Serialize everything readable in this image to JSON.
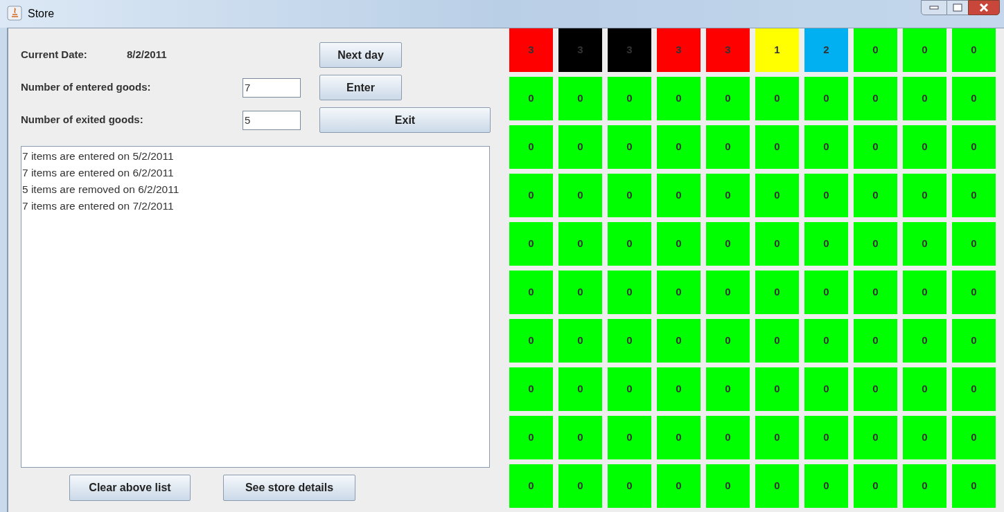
{
  "window": {
    "title": "Store"
  },
  "current_date": {
    "label": "Current Date:",
    "value": "8/2/2011"
  },
  "next_day_button": "Next day",
  "entered": {
    "label": "Number of entered goods:",
    "value": "7",
    "button": "Enter"
  },
  "exited": {
    "label": "Number of exited goods:",
    "value": "5",
    "button": "Exit"
  },
  "log": [
    "7 items are entered on 5/2/2011",
    "7 items are entered on 6/2/2011",
    "5 items are removed on 6/2/2011",
    "7 items are entered on 7/2/2011"
  ],
  "bottom_buttons": [
    "Clear above list",
    "See store details"
  ],
  "grid": [
    [
      {
        "value": "3",
        "color": "#ff0000"
      },
      {
        "value": "3",
        "color": "#000000"
      },
      {
        "value": "3",
        "color": "#000000"
      },
      {
        "value": "3",
        "color": "#ff0000"
      },
      {
        "value": "3",
        "color": "#ff0000"
      },
      {
        "value": "1",
        "color": "#ffff00"
      },
      {
        "value": "2",
        "color": "#00b0f0"
      },
      {
        "value": "0",
        "color": "#00ff00"
      },
      {
        "value": "0",
        "color": "#00ff00"
      },
      {
        "value": "0",
        "color": "#00ff00"
      }
    ],
    [
      {
        "value": "0",
        "color": "#00ff00"
      },
      {
        "value": "0",
        "color": "#00ff00"
      },
      {
        "value": "0",
        "color": "#00ff00"
      },
      {
        "value": "0",
        "color": "#00ff00"
      },
      {
        "value": "0",
        "color": "#00ff00"
      },
      {
        "value": "0",
        "color": "#00ff00"
      },
      {
        "value": "0",
        "color": "#00ff00"
      },
      {
        "value": "0",
        "color": "#00ff00"
      },
      {
        "value": "0",
        "color": "#00ff00"
      },
      {
        "value": "0",
        "color": "#00ff00"
      }
    ],
    [
      {
        "value": "0",
        "color": "#00ff00"
      },
      {
        "value": "0",
        "color": "#00ff00"
      },
      {
        "value": "0",
        "color": "#00ff00"
      },
      {
        "value": "0",
        "color": "#00ff00"
      },
      {
        "value": "0",
        "color": "#00ff00"
      },
      {
        "value": "0",
        "color": "#00ff00"
      },
      {
        "value": "0",
        "color": "#00ff00"
      },
      {
        "value": "0",
        "color": "#00ff00"
      },
      {
        "value": "0",
        "color": "#00ff00"
      },
      {
        "value": "0",
        "color": "#00ff00"
      }
    ],
    [
      {
        "value": "0",
        "color": "#00ff00"
      },
      {
        "value": "0",
        "color": "#00ff00"
      },
      {
        "value": "0",
        "color": "#00ff00"
      },
      {
        "value": "0",
        "color": "#00ff00"
      },
      {
        "value": "0",
        "color": "#00ff00"
      },
      {
        "value": "0",
        "color": "#00ff00"
      },
      {
        "value": "0",
        "color": "#00ff00"
      },
      {
        "value": "0",
        "color": "#00ff00"
      },
      {
        "value": "0",
        "color": "#00ff00"
      },
      {
        "value": "0",
        "color": "#00ff00"
      }
    ],
    [
      {
        "value": "0",
        "color": "#00ff00"
      },
      {
        "value": "0",
        "color": "#00ff00"
      },
      {
        "value": "0",
        "color": "#00ff00"
      },
      {
        "value": "0",
        "color": "#00ff00"
      },
      {
        "value": "0",
        "color": "#00ff00"
      },
      {
        "value": "0",
        "color": "#00ff00"
      },
      {
        "value": "0",
        "color": "#00ff00"
      },
      {
        "value": "0",
        "color": "#00ff00"
      },
      {
        "value": "0",
        "color": "#00ff00"
      },
      {
        "value": "0",
        "color": "#00ff00"
      }
    ],
    [
      {
        "value": "0",
        "color": "#00ff00"
      },
      {
        "value": "0",
        "color": "#00ff00"
      },
      {
        "value": "0",
        "color": "#00ff00"
      },
      {
        "value": "0",
        "color": "#00ff00"
      },
      {
        "value": "0",
        "color": "#00ff00"
      },
      {
        "value": "0",
        "color": "#00ff00"
      },
      {
        "value": "0",
        "color": "#00ff00"
      },
      {
        "value": "0",
        "color": "#00ff00"
      },
      {
        "value": "0",
        "color": "#00ff00"
      },
      {
        "value": "0",
        "color": "#00ff00"
      }
    ],
    [
      {
        "value": "0",
        "color": "#00ff00"
      },
      {
        "value": "0",
        "color": "#00ff00"
      },
      {
        "value": "0",
        "color": "#00ff00"
      },
      {
        "value": "0",
        "color": "#00ff00"
      },
      {
        "value": "0",
        "color": "#00ff00"
      },
      {
        "value": "0",
        "color": "#00ff00"
      },
      {
        "value": "0",
        "color": "#00ff00"
      },
      {
        "value": "0",
        "color": "#00ff00"
      },
      {
        "value": "0",
        "color": "#00ff00"
      },
      {
        "value": "0",
        "color": "#00ff00"
      }
    ],
    [
      {
        "value": "0",
        "color": "#00ff00"
      },
      {
        "value": "0",
        "color": "#00ff00"
      },
      {
        "value": "0",
        "color": "#00ff00"
      },
      {
        "value": "0",
        "color": "#00ff00"
      },
      {
        "value": "0",
        "color": "#00ff00"
      },
      {
        "value": "0",
        "color": "#00ff00"
      },
      {
        "value": "0",
        "color": "#00ff00"
      },
      {
        "value": "0",
        "color": "#00ff00"
      },
      {
        "value": "0",
        "color": "#00ff00"
      },
      {
        "value": "0",
        "color": "#00ff00"
      }
    ],
    [
      {
        "value": "0",
        "color": "#00ff00"
      },
      {
        "value": "0",
        "color": "#00ff00"
      },
      {
        "value": "0",
        "color": "#00ff00"
      },
      {
        "value": "0",
        "color": "#00ff00"
      },
      {
        "value": "0",
        "color": "#00ff00"
      },
      {
        "value": "0",
        "color": "#00ff00"
      },
      {
        "value": "0",
        "color": "#00ff00"
      },
      {
        "value": "0",
        "color": "#00ff00"
      },
      {
        "value": "0",
        "color": "#00ff00"
      },
      {
        "value": "0",
        "color": "#00ff00"
      }
    ],
    [
      {
        "value": "0",
        "color": "#00ff00"
      },
      {
        "value": "0",
        "color": "#00ff00"
      },
      {
        "value": "0",
        "color": "#00ff00"
      },
      {
        "value": "0",
        "color": "#00ff00"
      },
      {
        "value": "0",
        "color": "#00ff00"
      },
      {
        "value": "0",
        "color": "#00ff00"
      },
      {
        "value": "0",
        "color": "#00ff00"
      },
      {
        "value": "0",
        "color": "#00ff00"
      },
      {
        "value": "0",
        "color": "#00ff00"
      },
      {
        "value": "0",
        "color": "#00ff00"
      }
    ]
  ]
}
